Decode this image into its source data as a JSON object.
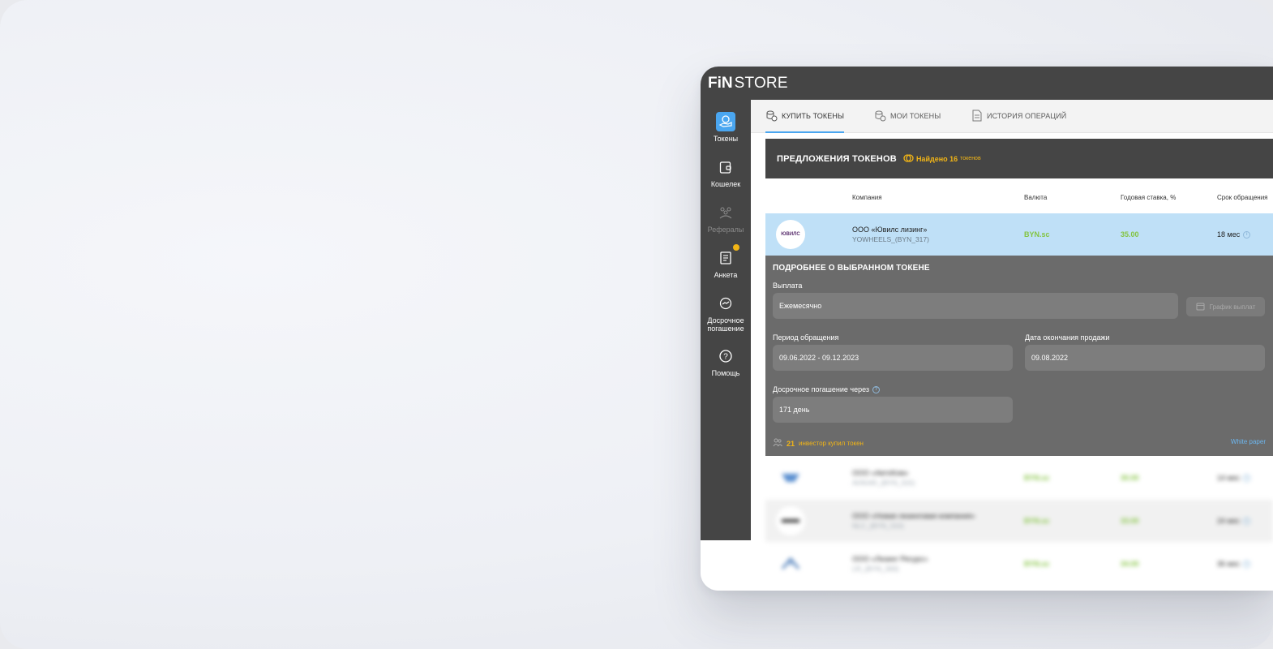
{
  "app": {
    "logo_fin": "FiN",
    "logo_store": "STORE"
  },
  "sidebar": {
    "items": [
      {
        "label": "Токены",
        "icon": "coin-hand-icon",
        "active": true
      },
      {
        "label": "Кошелек",
        "icon": "wallet-icon"
      },
      {
        "label": "Рефералы",
        "icon": "referrals-icon",
        "disabled": true
      },
      {
        "label": "Анкета",
        "icon": "form-icon",
        "badge": true
      },
      {
        "label": "Досрочное погашение",
        "icon": "handshake-icon"
      },
      {
        "label": "Помощь",
        "icon": "help-icon"
      }
    ]
  },
  "tabs": [
    {
      "label": "КУПИТЬ ТОКЕНЫ",
      "active": true
    },
    {
      "label": "МОИ ТОКЕНЫ"
    },
    {
      "label": "ИСТОРИЯ ОПЕРАЦИЙ"
    }
  ],
  "offers": {
    "title": "ПРЕДЛОЖЕНИЯ ТОКЕНОВ",
    "found_text": "Найдено 16",
    "found_suffix": "токенов",
    "columns": [
      "Компания",
      "Валюта",
      "Годовая ставка, %",
      "Срок обращения"
    ]
  },
  "selected_row": {
    "logo_text": "ЮВИЛС",
    "company": "ООО «Ювилс лизинг»",
    "ticker": "YOWHEELS_(BYN_317)",
    "currency": "BYN.sc",
    "rate": "35.00",
    "term": "18 мес"
  },
  "details": {
    "title": "ПОДРОБНЕЕ О ВЫБРАННОМ ТОКЕНЕ",
    "payout_label": "Выплата",
    "payout_value": "Ежемесячно",
    "schedule_button": "График выплат",
    "period_label": "Период обращения",
    "period_value": "09.06.2022 - 09.12.2023",
    "sale_end_label": "Дата окончания продажи",
    "sale_end_value": "09.08.2022",
    "early_label": "Досрочное погашение через",
    "early_value": "171 день",
    "investors_count": "21",
    "investors_text": "инвестор купил токен",
    "white_paper": "White paper"
  },
  "other_rows": [
    {
      "company": "ООО «АвтоКом»",
      "ticker": "AVIKAR_(BYN_315)",
      "currency": "BYN.sc",
      "rate": "30.00",
      "term": "14 мес"
    },
    {
      "company": "ООО «Новая лизинговая компания»",
      "ticker": "NLC_(BYN_310)",
      "currency": "BYN.sc",
      "rate": "33.00",
      "term": "24 мес"
    },
    {
      "company": "ООО «Лизинг Ресурс»",
      "ticker": "LR_(BYN_300)",
      "currency": "BYN.sc",
      "rate": "34.00",
      "term": "36 мес"
    }
  ],
  "colors": {
    "accent": "#4aa6f0",
    "dark": "#454545",
    "green": "#84c441",
    "yellow": "#f2b516",
    "selected_row": "#bfe0f7"
  }
}
